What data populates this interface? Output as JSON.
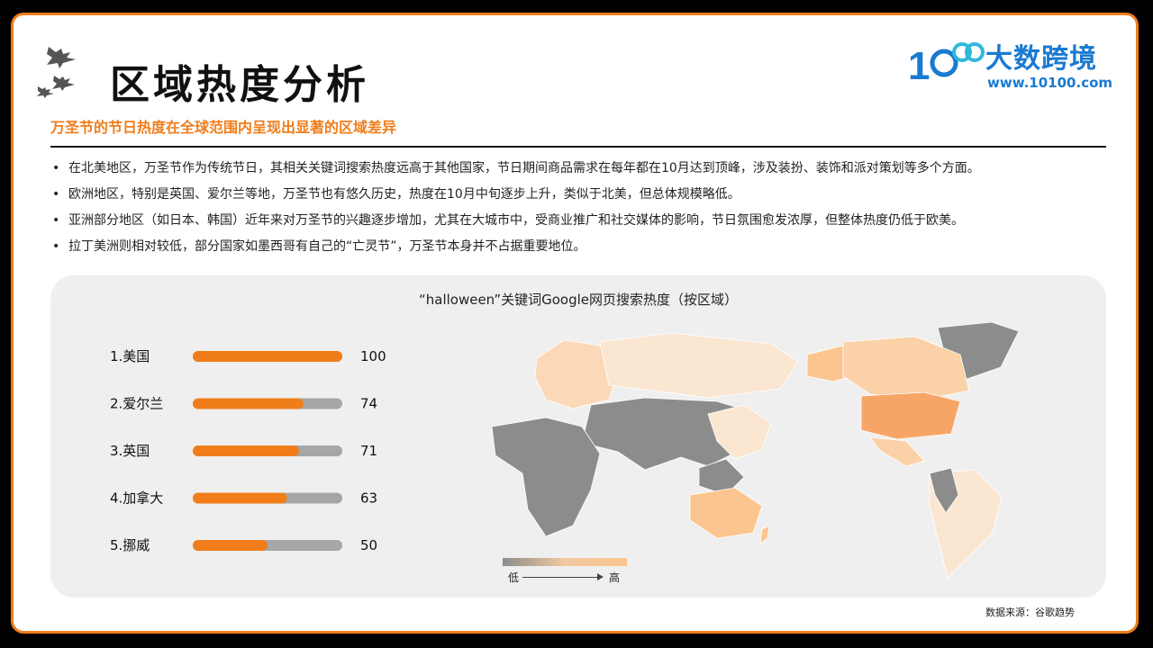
{
  "page": {
    "title": "区域热度分析",
    "subtitle": "万圣节的节日热度在全球范围内呈现出显著的区域差异",
    "brand": {
      "name_cn": "大数跨境",
      "url": "www.10100.com",
      "logo_mark": "10100"
    },
    "bullets": [
      "在北美地区，万圣节作为传统节日，其相关关键词搜索热度远高于其他国家，节日期间商品需求在每年都在10月达到顶峰，涉及装扮、装饰和派对策划等多个方面。",
      "欧洲地区，特别是英国、爱尔兰等地，万圣节也有悠久历史，热度在10月中旬逐步上升，类似于北美，但总体规模略低。",
      "亚洲部分地区（如日本、韩国）近年来对万圣节的兴趣逐步增加，尤其在大城市中，受商业推广和社交媒体的影响，节日氛围愈发浓厚，但整体热度仍低于欧美。",
      "拉丁美洲则相对较低，部分国家如墨西哥有自己的“亡灵节”，万圣节本身并不占据重要地位。"
    ],
    "source": "数据来源：谷歌趋势"
  },
  "chart_data": {
    "type": "bar",
    "orientation": "horizontal",
    "title": "“halloween”关键词Google网页搜索热度（按区域）",
    "categories": [
      "1.美国",
      "2.爱尔兰",
      "3.英国",
      "4.加拿大",
      "5.挪威"
    ],
    "values": [
      100,
      74,
      71,
      63,
      50
    ],
    "xlim": [
      0,
      100
    ],
    "bar_color": "#f07d1a",
    "track_color": "#a6a6a6",
    "map_legend": {
      "low": "低",
      "high": "高",
      "low_color": "#8c8c8c",
      "high_color": "#fbc58f"
    }
  }
}
